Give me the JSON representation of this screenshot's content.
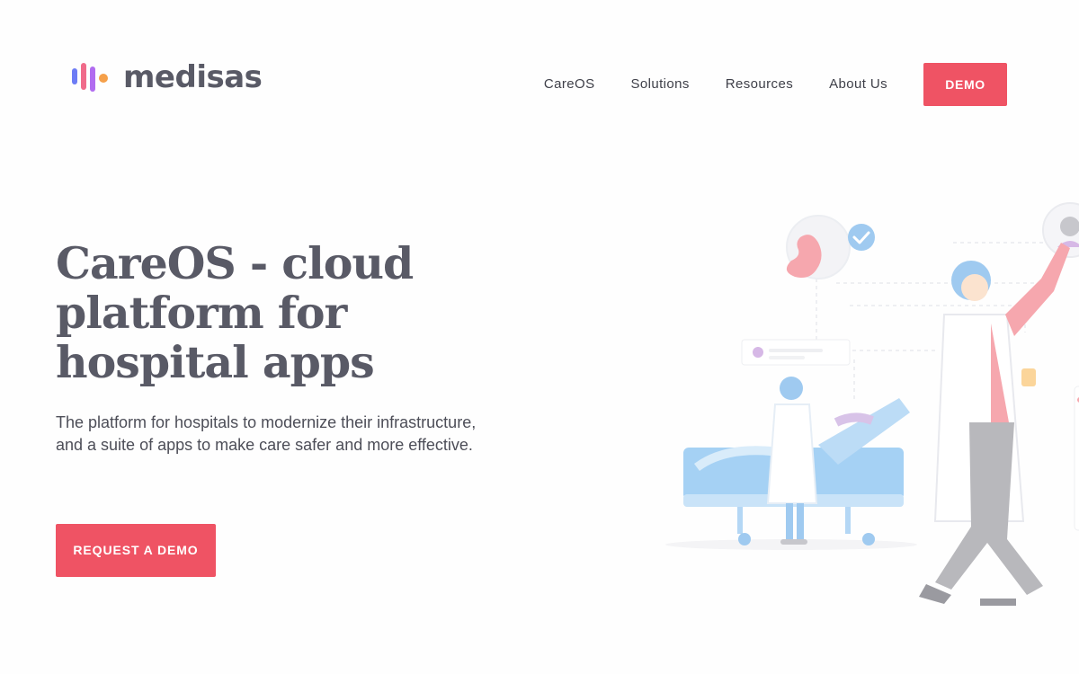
{
  "header": {
    "logo_text": "medisas",
    "logo_bar_colors": [
      "#6d7cf5",
      "#f06b8a",
      "#b16cf0",
      "#f5a04a"
    ],
    "nav": [
      {
        "label": "CareOS"
      },
      {
        "label": "Solutions"
      },
      {
        "label": "Resources"
      },
      {
        "label": "About Us"
      }
    ],
    "demo_label": "DEMO"
  },
  "hero": {
    "title": "CareOS - cloud platform for hospital apps",
    "subtitle": "The platform for hospitals to modernize their infrastructure, and a suite of apps to make care safer and more effective.",
    "cta_label": "REQUEST A DEMO"
  },
  "colors": {
    "accent": "#ef5364",
    "heading": "#595a66",
    "body_text": "#4d4e58"
  },
  "illustration": {
    "icons": [
      "hospital-bed-icon",
      "nurse-figure",
      "doctor-figure",
      "checkmark-badge-icon",
      "avatar-bubble-icon"
    ]
  }
}
